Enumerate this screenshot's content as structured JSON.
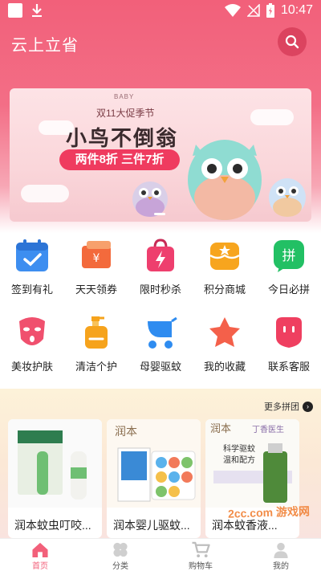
{
  "status_bar": {
    "time": "10:47"
  },
  "app": {
    "title": "云上立省"
  },
  "banner": {
    "tag": "BABY",
    "subtitle": "双11大促季节",
    "title": "小鸟不倒翁",
    "promo": "两件8折 三件7折"
  },
  "categories": [
    {
      "label": "签到有礼",
      "icon": "calendar-check-icon",
      "color": "#3d8ef0"
    },
    {
      "label": "天天领券",
      "icon": "coupon-icon",
      "color": "#f36a3c"
    },
    {
      "label": "限时秒杀",
      "icon": "flash-bag-icon",
      "color": "#ee3f6e"
    },
    {
      "label": "积分商城",
      "icon": "star-shop-icon",
      "color": "#f7a51e"
    },
    {
      "label": "今日必拼",
      "icon": "pin-icon",
      "color": "#22c064"
    },
    {
      "label": "美妆护肤",
      "icon": "face-mask-icon",
      "color": "#f0506e"
    },
    {
      "label": "清洁个护",
      "icon": "bottle-icon",
      "color": "#f6a31c"
    },
    {
      "label": "母婴驱蚊",
      "icon": "stroller-icon",
      "color": "#2f8cf0"
    },
    {
      "label": "我的收藏",
      "icon": "star-icon",
      "color": "#f4604a"
    },
    {
      "label": "联系客服",
      "icon": "chat-icon",
      "color": "#ef3f60"
    }
  ],
  "group_buy": {
    "more_label": "更多拼团",
    "products": [
      {
        "name": "润本蚊虫叮咬..."
      },
      {
        "name": "润本婴儿驱蚊..."
      },
      {
        "name": "润本蚊香液..."
      }
    ]
  },
  "watermark": "2cc.com 游戏网",
  "tabs": [
    {
      "label": "首页",
      "icon": "home-icon",
      "active": true
    },
    {
      "label": "分类",
      "icon": "clover-icon",
      "active": false
    },
    {
      "label": "购物车",
      "icon": "cart-icon",
      "active": false
    },
    {
      "label": "我的",
      "icon": "user-icon",
      "active": false
    }
  ],
  "colors": {
    "accent": "#f2607a",
    "promo_red": "#ef3b5f"
  }
}
